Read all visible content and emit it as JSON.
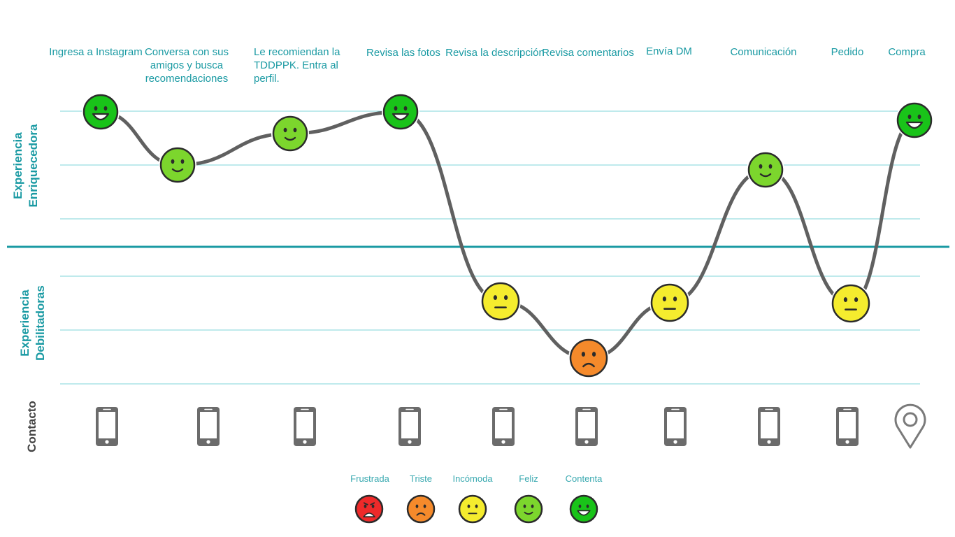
{
  "axes": {
    "enriching": "Experiencia Enriquecedora",
    "debilitating": "Experiencia Debilitadoras",
    "contact": "Contacto"
  },
  "colors": {
    "teal": "#1a9aa3",
    "gridline": "#7fd4d8",
    "curve": "#606060",
    "contact_icon": "#6b6b6b"
  },
  "emotions": {
    "frustrada": {
      "label": "Frustrada",
      "color": "#ee2a2a",
      "level": 0
    },
    "triste": {
      "label": "Triste",
      "color": "#f58a2b",
      "level": 1
    },
    "incomoda": {
      "label": "Incómoda",
      "color": "#f5ec2e",
      "level": 2
    },
    "feliz": {
      "label": "Feliz",
      "color": "#7cd62d",
      "level": 3
    },
    "contenta": {
      "label": "Contenta",
      "color": "#19c319",
      "level": 4
    }
  },
  "legend_order": [
    "frustrada",
    "triste",
    "incomoda",
    "feliz",
    "contenta"
  ],
  "steps": [
    {
      "label": "Ingresa a Instagram",
      "emotion": "contenta",
      "contact": "phone-icon"
    },
    {
      "label": "Conversa con sus amigos y busca recomendaciones",
      "emotion": "feliz",
      "contact": "phone-icon"
    },
    {
      "label": "Le recomiendan la TDDPPK. Entra al perfil.",
      "emotion": "feliz",
      "contact": "phone-icon"
    },
    {
      "label": "Revisa las fotos",
      "emotion": "contenta",
      "contact": "phone-icon"
    },
    {
      "label": "Revisa la descripción",
      "emotion": "incomoda",
      "contact": "phone-icon"
    },
    {
      "label": "Revisa comentarios",
      "emotion": "triste",
      "contact": "phone-icon"
    },
    {
      "label": "Envía DM",
      "emotion": "incomoda",
      "contact": "phone-icon"
    },
    {
      "label": "Comunicación",
      "emotion": "feliz",
      "contact": "phone-icon"
    },
    {
      "label": "Pedido",
      "emotion": "incomoda",
      "contact": "phone-icon"
    },
    {
      "label": "Compra",
      "emotion": "contenta",
      "contact": "location-pin-icon"
    }
  ]
}
